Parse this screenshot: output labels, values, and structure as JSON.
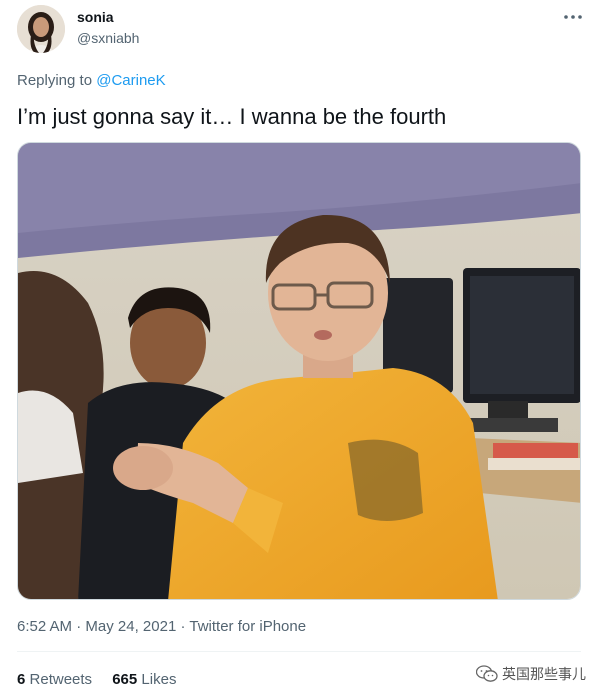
{
  "author": {
    "name": "sonia",
    "handle": "@sxniabh"
  },
  "reply": {
    "prefix": "Replying to",
    "mention": "@CarineK"
  },
  "tweet": {
    "text": "I’m just gonna say it… I wanna be the fourth"
  },
  "meta": {
    "time": "6:52 AM",
    "sep1": " · ",
    "date": "May 24, 2021",
    "sep2": " · ",
    "source": "Twitter for iPhone"
  },
  "stats": {
    "retweets_count": "6",
    "retweets_label": "Retweets",
    "likes_count": "665",
    "likes_label": "Likes"
  },
  "watermark": {
    "text": "英国那些事儿"
  },
  "icons": {
    "more": "more-horizontal-icon",
    "watermark": "wechat-icon"
  },
  "colors": {
    "link": "#1d9bf0",
    "secondary_text": "#536471",
    "primary_text": "#0f1419"
  }
}
